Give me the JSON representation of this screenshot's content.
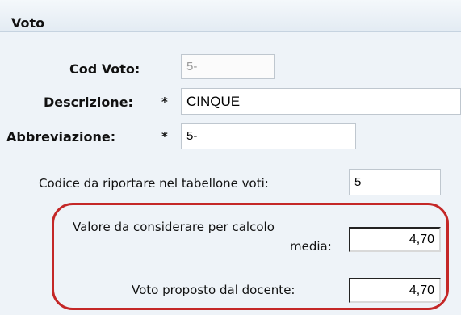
{
  "panel": {
    "title": "Voto"
  },
  "fields": {
    "cod_voto": {
      "label": "Cod Voto:",
      "value": "5-"
    },
    "descrizione": {
      "label": "Descrizione:",
      "required": "*",
      "value": "CINQUE"
    },
    "abbreviazione": {
      "label": "Abbreviazione:",
      "required": "*",
      "value": "5-"
    },
    "codice_tabellone": {
      "label": "Codice da riportare nel tabellone voti:",
      "value": "5"
    },
    "valore_media": {
      "label_line1": "Valore da considerare per calcolo",
      "label_line2": "media:",
      "value": "4,70"
    },
    "voto_proposto": {
      "label": "Voto proposto dal docente:",
      "value": "4,70"
    }
  },
  "colors": {
    "highlight": "#c42727",
    "background": "#eef3f8"
  }
}
